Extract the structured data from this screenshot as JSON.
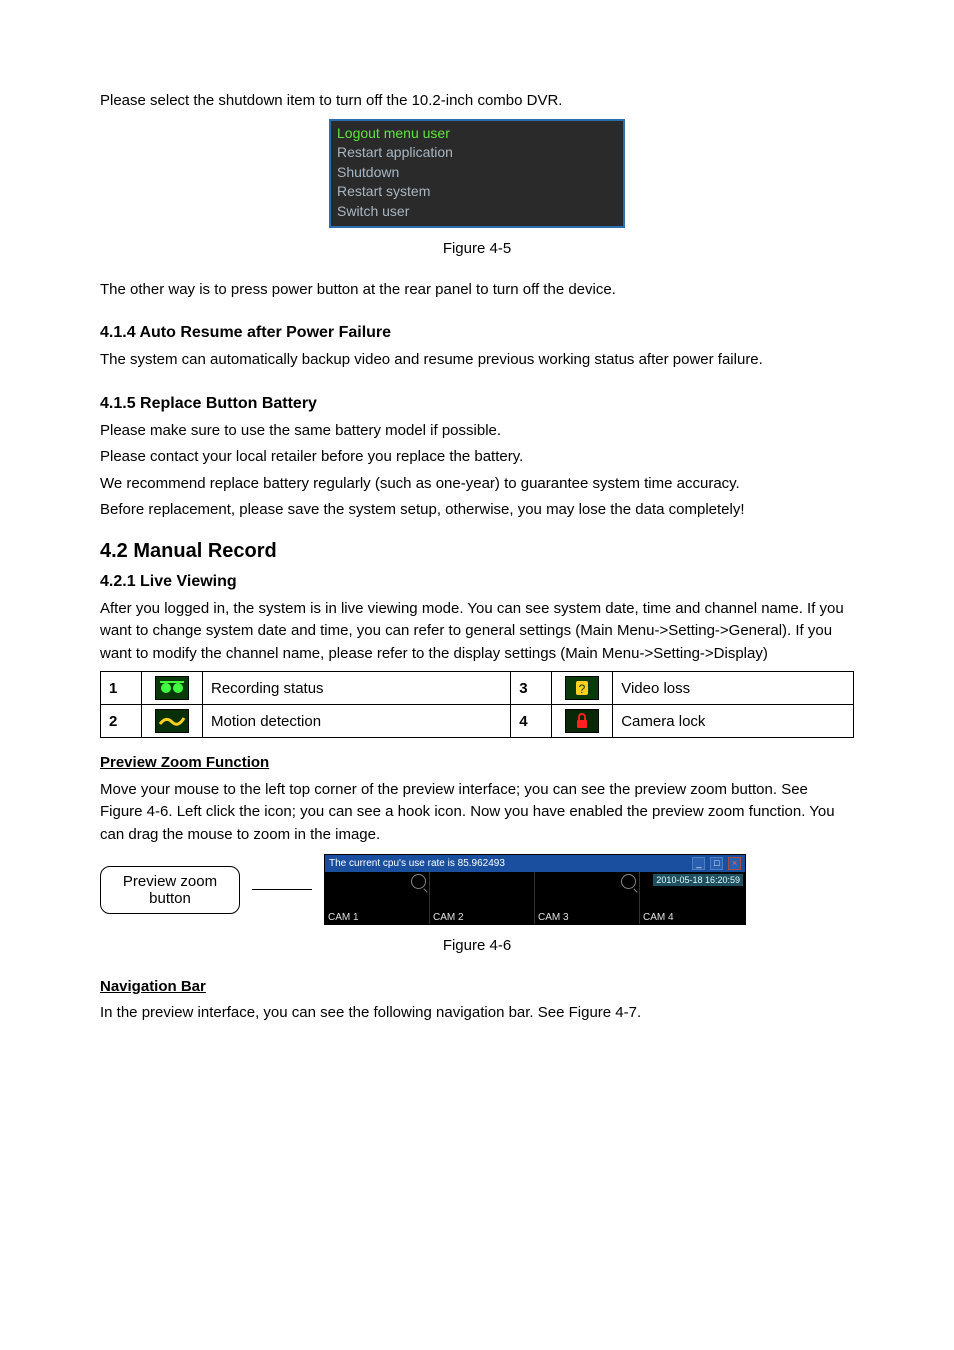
{
  "intro": "Please select the shutdown item to turn off the 10.2-inch combo DVR.",
  "shutdown_menu": {
    "items": [
      "Logout menu user",
      "Restart application",
      "Shutdown",
      "Restart system",
      "Switch user"
    ]
  },
  "fig45_caption": "Figure 4-5",
  "other_way": " The other way is to press power button at the rear panel to turn off the device.",
  "s414": {
    "heading": "4.1.4   Auto Resume after Power Failure",
    "body": "The system can automatically backup video and resume previous working status after power failure."
  },
  "s415": {
    "heading": "4.1.5  Replace Button Battery",
    "lines": [
      "Please make sure to use the same battery model if possible.",
      "Please contact your local retailer before you replace the battery.",
      "We recommend replace battery regularly (such as one-year) to guarantee system time accuracy.",
      "Before replacement, please save the system setup, otherwise, you may lose the data completely!"
    ]
  },
  "s42_heading": "4.2   Manual Record",
  "s421": {
    "heading": "4.2.1   Live Viewing",
    "body": "After you logged in, the system is in live viewing mode. You can see system date, time and channel name. If you want to change system date and time, you can refer to general settings (Main Menu->Setting->General). If you want to modify the channel name, please refer to the display settings (Main Menu->Setting->Display)"
  },
  "icon_table": {
    "rows": [
      {
        "n1": "1",
        "label1": "Recording status",
        "n2": "3",
        "label2": "Video loss"
      },
      {
        "n1": "2",
        "label1": "Motion detection",
        "n2": "4",
        "label2": "Camera lock"
      }
    ]
  },
  "pzf": {
    "heading": "Preview Zoom Function",
    "body": "Move your mouse to the left top corner of the preview interface; you can see the preview zoom button. See Figure 4-6. Left click the icon; you can see a hook icon. Now you have enabled the preview zoom function. You can drag the mouse to zoom in the image."
  },
  "callout": "Preview zoom button",
  "dvr": {
    "title": "The current cpu's use rate is  85.962493",
    "datetime": "2010-05-18 16:20:59",
    "cams": [
      "CAM 1",
      "CAM 2",
      "CAM 3",
      "CAM 4"
    ]
  },
  "fig46_caption": "Figure 4-6",
  "navbar": {
    "heading": "Navigation Bar",
    "body": "In the preview interface, you can see the following navigation bar. See Figure 4-7."
  }
}
